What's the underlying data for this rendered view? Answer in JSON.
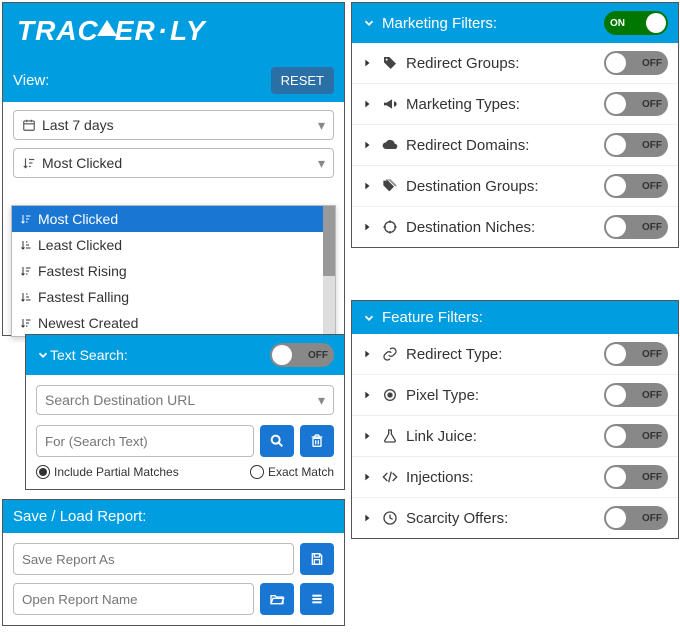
{
  "brand": {
    "part1": "TRAC",
    "part2": "ER",
    "part3": "LY"
  },
  "view": {
    "label": "View:",
    "reset": "RESET",
    "date_range": "Last 7 days",
    "sort_selected": "Most Clicked",
    "sort_options": [
      "Most Clicked",
      "Least Clicked",
      "Fastest Rising",
      "Fastest Falling",
      "Newest Created"
    ]
  },
  "text_search": {
    "header": "Text Search:",
    "state": "OFF",
    "url_dropdown": "Search Destination URL",
    "placeholder": "For (Search Text)",
    "partial": "Include Partial Matches",
    "exact": "Exact Match"
  },
  "save_load": {
    "header": "Save / Load Report:",
    "save_placeholder": "Save Report As",
    "open_placeholder": "Open Report Name"
  },
  "marketing": {
    "header": "Marketing Filters:",
    "state": "ON",
    "filters": [
      {
        "label": "Redirect Groups:"
      },
      {
        "label": "Marketing Types:"
      },
      {
        "label": "Redirect Domains:"
      },
      {
        "label": "Destination Groups:"
      },
      {
        "label": "Destination Niches:"
      }
    ]
  },
  "feature": {
    "header": "Feature Filters:",
    "filters": [
      {
        "label": "Redirect Type:"
      },
      {
        "label": "Pixel Type:"
      },
      {
        "label": "Link Juice:"
      },
      {
        "label": "Injections:"
      },
      {
        "label": "Scarcity Offers:"
      }
    ]
  },
  "off_label": "OFF"
}
